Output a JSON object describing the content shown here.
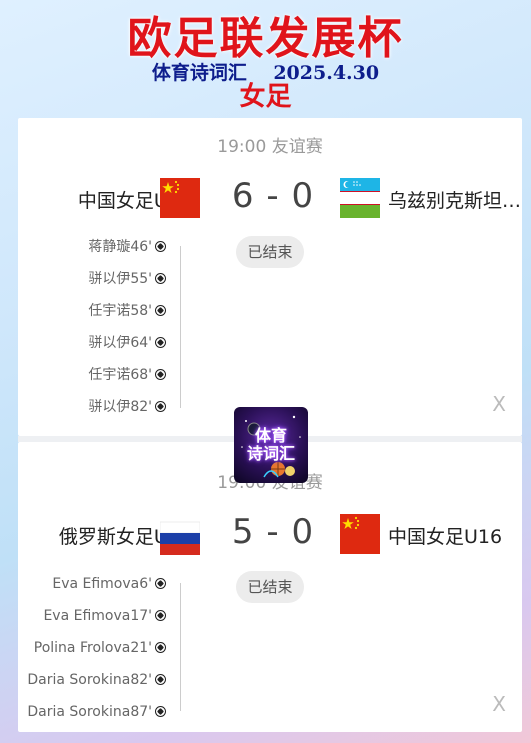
{
  "title": "欧足联发展杯",
  "subtitle": "体育诗词汇    2025.4.30",
  "category": "女足",
  "logo": {
    "line1": "体育",
    "line2": "诗词汇"
  },
  "matches": [
    {
      "header": "19:00 友谊赛",
      "home": "中国女足U16",
      "away": "乌兹别克斯坦…",
      "score": "6 - 0",
      "status": "已结束",
      "home_flag": "china-flag",
      "away_flag": "uzbekistan-flag",
      "events": [
        "蒋静璇46'",
        "骈以伊55'",
        "任宇诺58'",
        "骈以伊64'",
        "任宇诺68'",
        "骈以伊82'"
      ],
      "close": "X"
    },
    {
      "header": "19:00 友谊赛",
      "home": "俄罗斯女足U16",
      "away": "中国女足U16",
      "score": "5 - 0",
      "status": "已结束",
      "home_flag": "russia-flag",
      "away_flag": "china-flag",
      "events": [
        "Eva Efimova6'",
        "Eva Efimova17'",
        "Polina Frolova21'",
        "Daria Sorokina82'",
        "Daria Sorokina87'"
      ],
      "close": "X"
    }
  ],
  "colors": {
    "title_red": "#e0141b",
    "subtitle_navy": "#0d1d8c",
    "china_red": "#de2910",
    "star_yellow": "#ffde00"
  }
}
